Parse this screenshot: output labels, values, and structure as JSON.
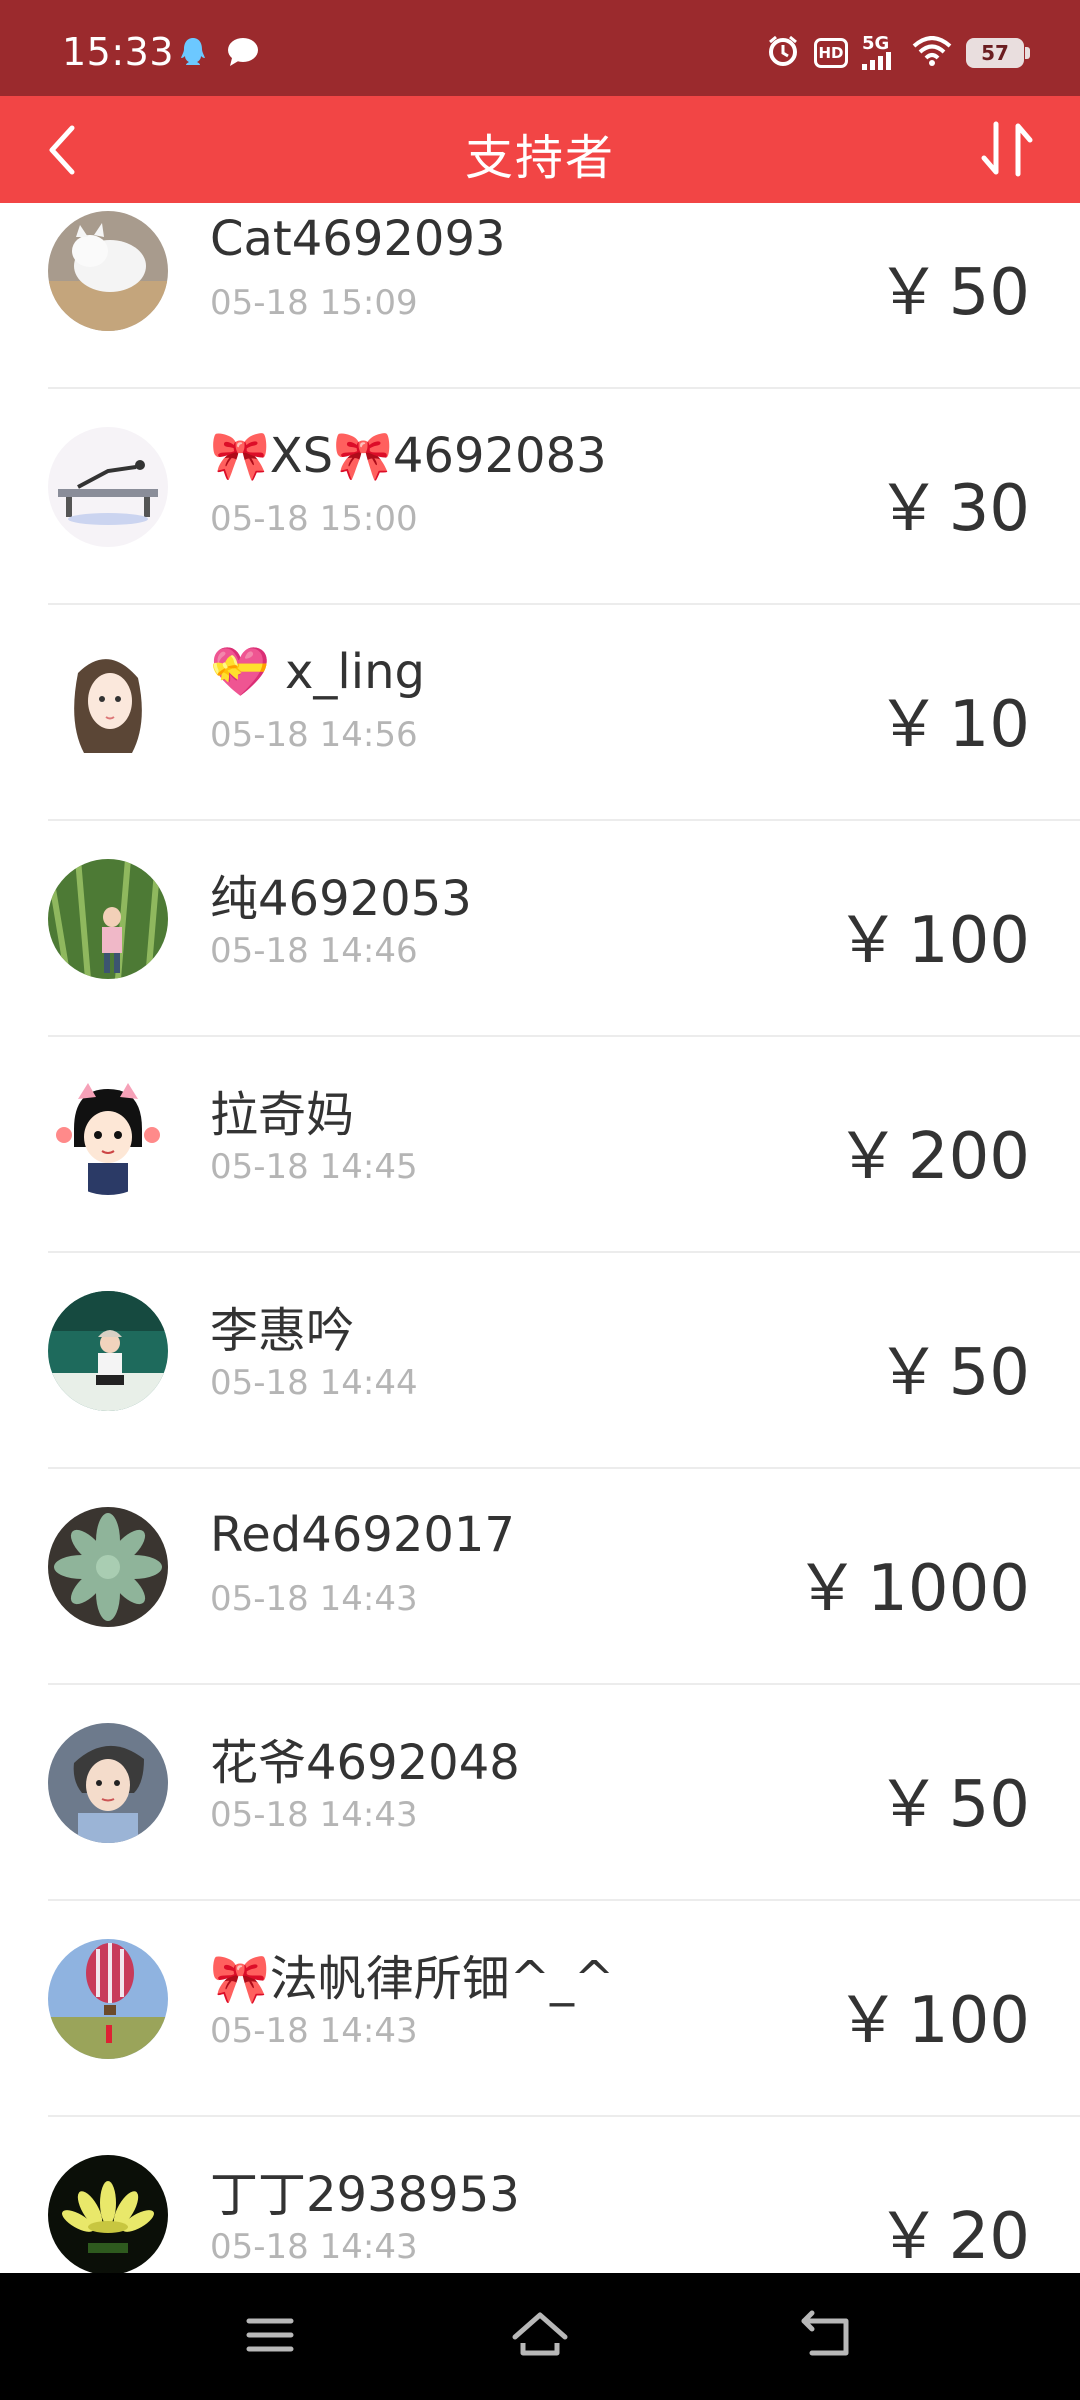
{
  "status_bar": {
    "time": "15:33",
    "hd_label": "HD",
    "network_label": "5G",
    "battery": "57"
  },
  "header": {
    "title": "支持者",
    "back_icon": "chevron-left-icon",
    "sort_icon": "sort-arrows-icon",
    "background_color": "#f24545",
    "status_bar_color": "#9b2a2d"
  },
  "currency_symbol": "￥",
  "supporters": [
    {
      "name": "Cat4692093",
      "time": "05-18 15:09",
      "amount": "50"
    },
    {
      "name": "🎀XS🎀4692083",
      "time": "05-18 15:00",
      "amount": "30"
    },
    {
      "name": "💝 x_ling",
      "time": "05-18 14:56",
      "amount": "10"
    },
    {
      "name": "纯4692053",
      "time": "05-18 14:46",
      "amount": "100"
    },
    {
      "name": "拉奇妈",
      "time": "05-18 14:45",
      "amount": "200"
    },
    {
      "name": "李惠吟",
      "time": "05-18 14:44",
      "amount": "50"
    },
    {
      "name": "Red4692017",
      "time": "05-18 14:43",
      "amount": "1000"
    },
    {
      "name": "花爷4692048",
      "time": "05-18 14:43",
      "amount": "50"
    },
    {
      "name": "🎀法帆律所钿^_^",
      "time": "05-18 14:43",
      "amount": "100"
    },
    {
      "name": "丁丁2938953",
      "time": "05-18 14:43",
      "amount": "20"
    }
  ],
  "nav_bar": {
    "menu_icon": "menu-icon",
    "home_icon": "home-icon",
    "back_icon": "back-icon"
  }
}
